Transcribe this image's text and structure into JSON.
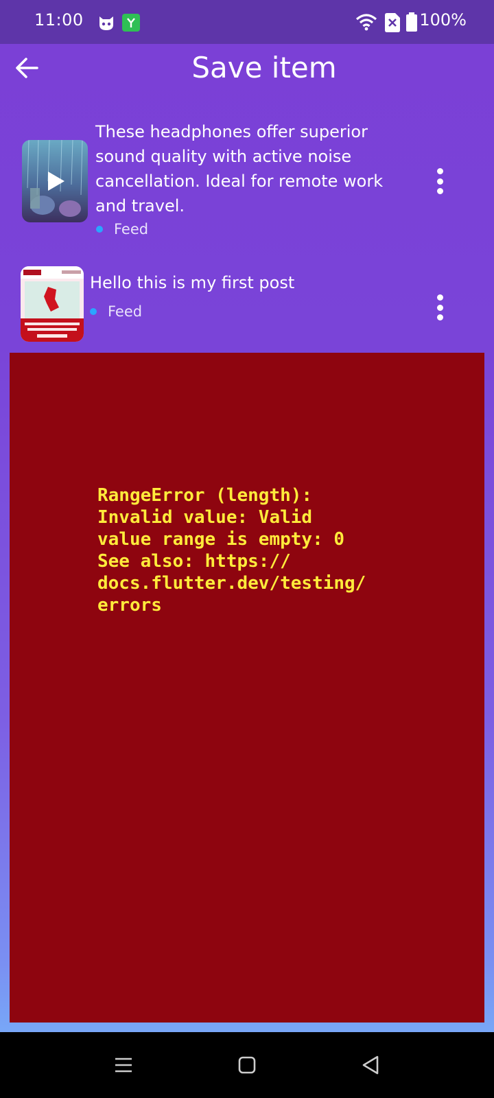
{
  "status_bar": {
    "time": "11:00",
    "battery": "100%",
    "icons": [
      "cat-face-icon",
      "app-notification-icon",
      "wifi-icon",
      "sim-off-icon",
      "battery-icon"
    ]
  },
  "app_bar": {
    "title": "Save item",
    "back_icon": "arrow-left-icon"
  },
  "items": [
    {
      "text": "These headphones offer superior sound quality with active noise cancellation. Ideal for remote work and travel.",
      "tag": "Feed",
      "thumb_icon": "video-play-icon"
    },
    {
      "text": "Hello this is my first post",
      "tag": "Feed"
    }
  ],
  "error": {
    "message": "RangeError (length):\nInvalid value: Valid\nvalue range is empty: 0\nSee also: https://\ndocs.flutter.dev/testing/\nerrors"
  },
  "nav_bar": {
    "icons": [
      "menu-icon",
      "home-square-icon",
      "back-triangle-icon"
    ]
  },
  "colors": {
    "status_bar": "#5e35a9",
    "background_top": "#7b3fd6",
    "background_bottom": "#78a6f7",
    "error_bg": "#8e050f",
    "error_text": "#ffeb3b",
    "tag_dot": "#2aa6ff"
  }
}
